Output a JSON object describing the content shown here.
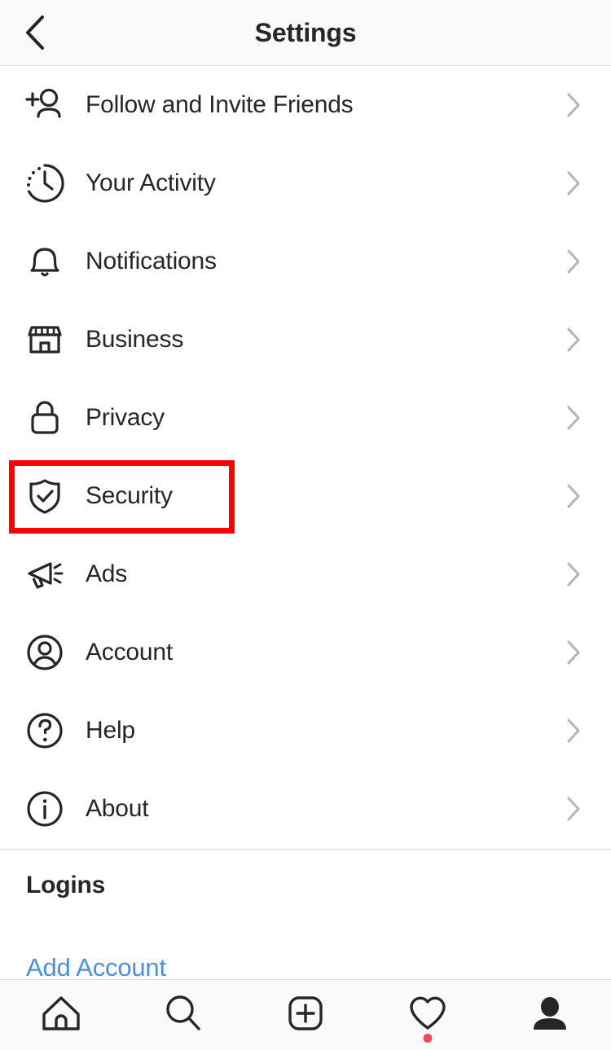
{
  "header": {
    "title": "Settings",
    "back_icon": "chevron-left-icon"
  },
  "list": {
    "items": [
      {
        "label": "Follow and Invite Friends",
        "icon": "person-add-icon",
        "chevron": "chevron-right-icon"
      },
      {
        "label": "Your Activity",
        "icon": "activity-clock-icon",
        "chevron": "chevron-right-icon"
      },
      {
        "label": "Notifications",
        "icon": "bell-icon",
        "chevron": "chevron-right-icon"
      },
      {
        "label": "Business",
        "icon": "storefront-icon",
        "chevron": "chevron-right-icon"
      },
      {
        "label": "Privacy",
        "icon": "lock-icon",
        "chevron": "chevron-right-icon"
      },
      {
        "label": "Security",
        "icon": "shield-check-icon",
        "chevron": "chevron-right-icon"
      },
      {
        "label": "Ads",
        "icon": "megaphone-icon",
        "chevron": "chevron-right-icon"
      },
      {
        "label": "Account",
        "icon": "person-circle-icon",
        "chevron": "chevron-right-icon"
      },
      {
        "label": "Help",
        "icon": "question-circle-icon",
        "chevron": "chevron-right-icon"
      },
      {
        "label": "About",
        "icon": "info-circle-icon",
        "chevron": "chevron-right-icon"
      }
    ]
  },
  "highlight": {
    "target_label": "Security",
    "color": "#ff0000"
  },
  "logins": {
    "section_title": "Logins",
    "add_account_label": "Add Account",
    "link_color": "#4a90d9"
  },
  "tabbar": {
    "items": [
      {
        "name": "home",
        "icon": "home-icon",
        "badge": false
      },
      {
        "name": "search",
        "icon": "search-icon",
        "badge": false
      },
      {
        "name": "create",
        "icon": "plus-square-icon",
        "badge": false
      },
      {
        "name": "activity",
        "icon": "heart-icon",
        "badge": true
      },
      {
        "name": "profile",
        "icon": "profile-filled-icon",
        "badge": false
      }
    ],
    "badge_color": "#ed4956"
  }
}
